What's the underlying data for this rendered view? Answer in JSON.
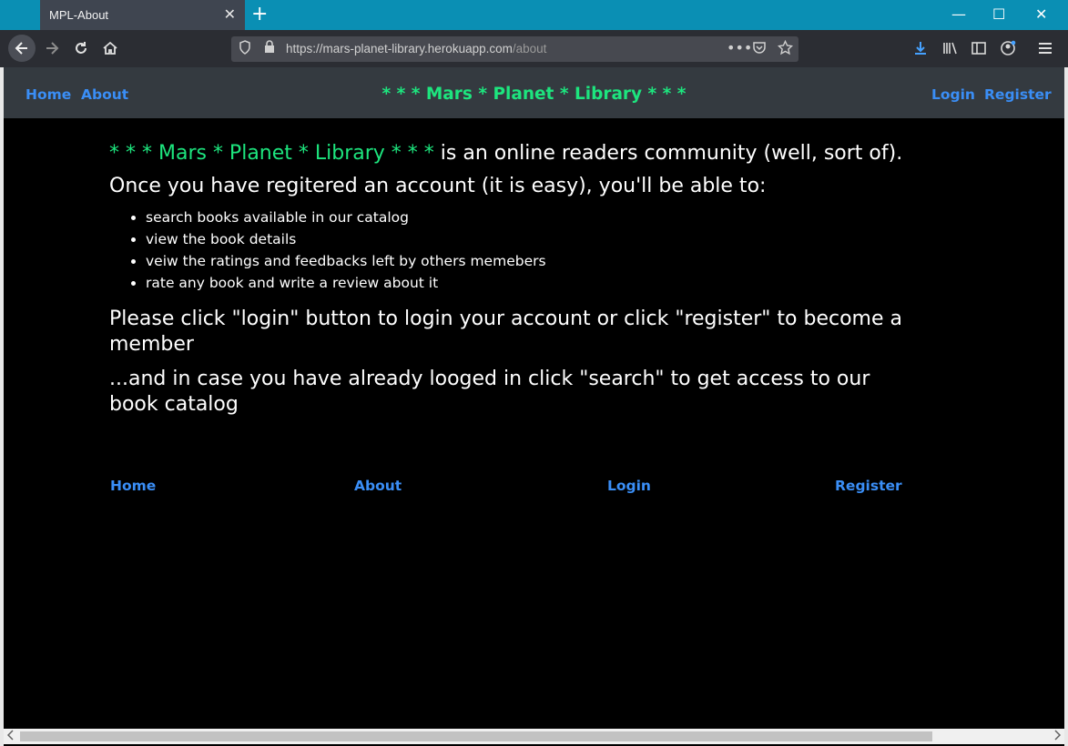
{
  "browser": {
    "tab_title": "MPL-About",
    "tab_close": "✕",
    "new_tab": "+",
    "url_host": "https://mars-planet-library.herokuapp.com",
    "url_path": "/about",
    "minimize": "—",
    "maximize": "☐",
    "close": "✕"
  },
  "header": {
    "nav_home": "Home",
    "nav_about": "About",
    "brand": "* * * Mars * Planet * Library * * *",
    "nav_login": "Login",
    "nav_register": "Register"
  },
  "content": {
    "brand_inline": "* * * Mars * Planet * Library * * *",
    "lead_rest": " is an online readers community (well, sort of).",
    "line2": "Once you have regitered an account (it is easy), you'll be able to:",
    "features": [
      "search books available in our catalog",
      "view the book details",
      "veiw the ratings and feedbacks left by others memebers",
      "rate any book and write a review about it"
    ],
    "para1": "Please click \"login\" button to login your account or click \"register\" to become a member",
    "para2": "...and in case you have already looged in click \"search\" to get access to our book catalog"
  },
  "footer": {
    "home": "Home",
    "about": "About",
    "login": "Login",
    "register": "Register"
  },
  "colors": {
    "brand_green": "#1de57e",
    "link_blue": "#3a8ef6",
    "titlebar": "#0a8fb4",
    "header_bg": "#343a40"
  }
}
